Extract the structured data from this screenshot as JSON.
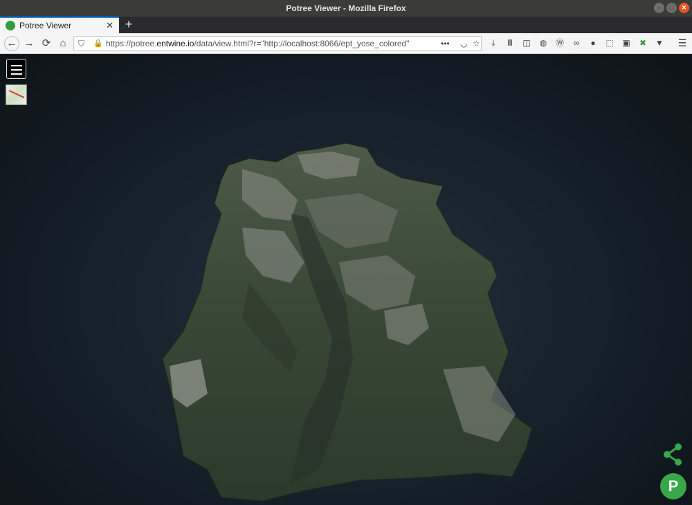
{
  "window": {
    "title": "Potree Viewer - Mozilla Firefox"
  },
  "tabs": [
    {
      "label": "Potree Viewer",
      "favicon": "potree-icon"
    }
  ],
  "navbar": {
    "url_prefix": "https://potree.",
    "url_domain": "entwine.io",
    "url_path": "/data/view.html?r=\"http://localhost:8066/ept_yose_colored\"",
    "more": "•••"
  },
  "toolbar_icons": [
    "downloads-icon",
    "library-icon",
    "sidebar-icon",
    "globe-icon",
    "wordpress-icon",
    "glasses-icon",
    "account-icon",
    "screenshot-icon",
    "selenium-icon",
    "puzzle-icon",
    "filter-icon"
  ],
  "viewer": {
    "background": "#17222c",
    "accent": "#39a84a",
    "logo_glyph": "P"
  }
}
